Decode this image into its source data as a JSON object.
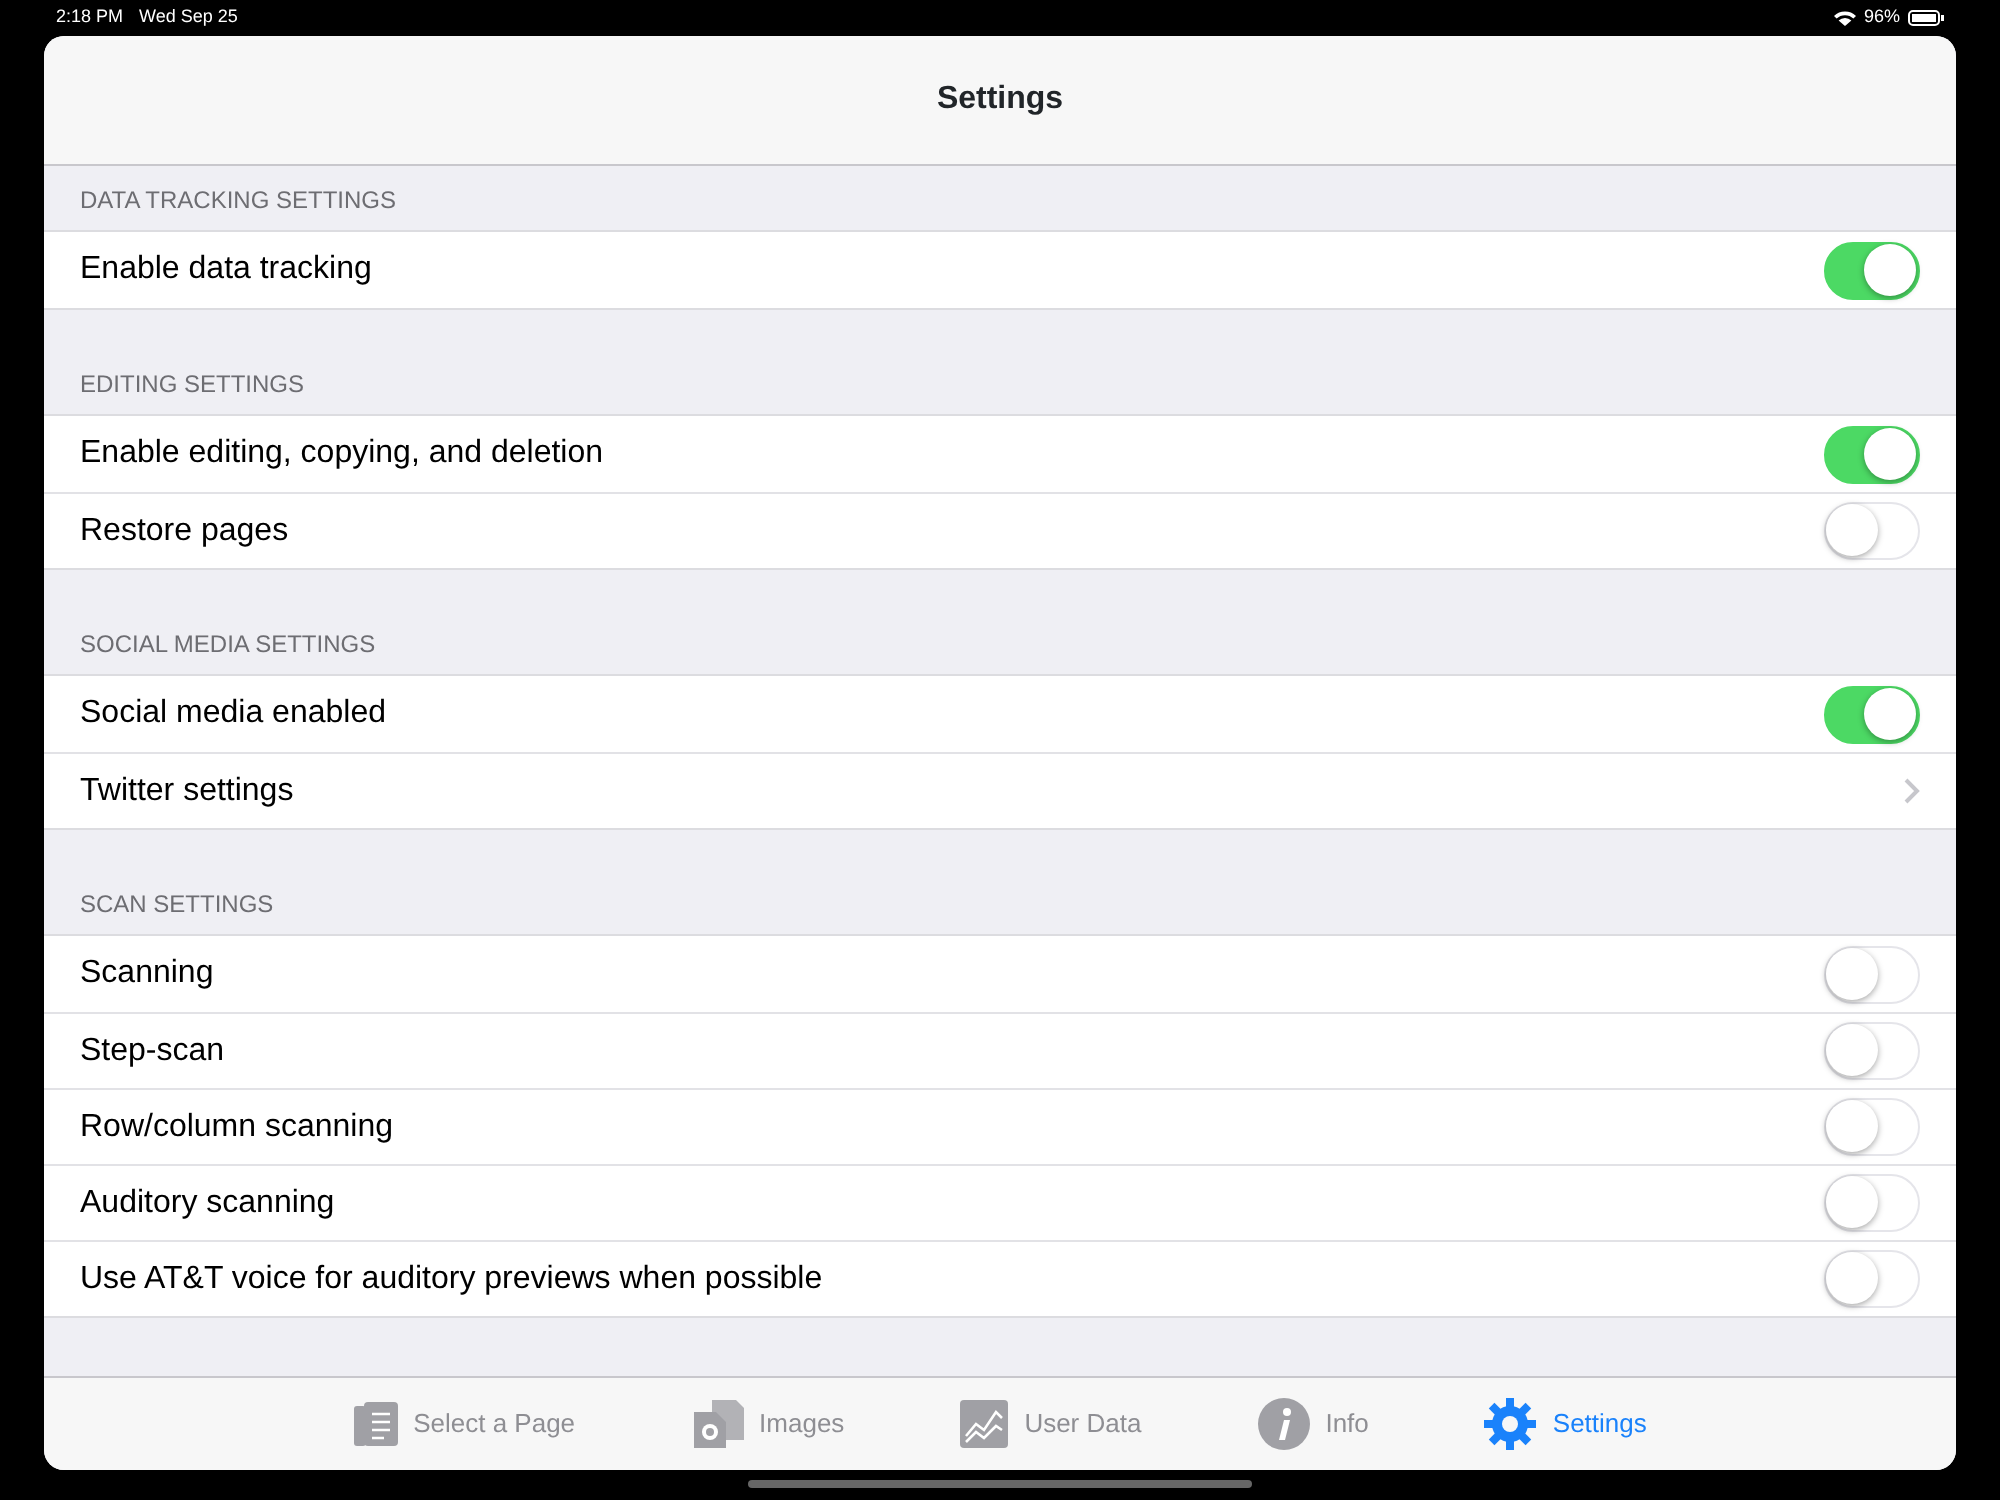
{
  "status_bar": {
    "time": "2:18 PM",
    "date": "Wed Sep 25",
    "battery": "96%"
  },
  "navigation_bar": {
    "title": "Settings"
  },
  "sections": [
    {
      "header": "DATA TRACKING SETTINGS",
      "rows": [
        {
          "kind": "toggle",
          "label": "Enable data tracking",
          "on": true
        }
      ]
    },
    {
      "header": "EDITING SETTINGS",
      "rows": [
        {
          "kind": "toggle",
          "label": "Enable editing, copying, and deletion",
          "on": true
        },
        {
          "kind": "toggle",
          "label": "Restore pages",
          "on": false
        }
      ]
    },
    {
      "header": "SOCIAL MEDIA SETTINGS",
      "rows": [
        {
          "kind": "toggle",
          "label": "Social media enabled",
          "on": true
        },
        {
          "kind": "link",
          "label": "Twitter settings"
        }
      ]
    },
    {
      "header": "SCAN SETTINGS",
      "rows": [
        {
          "kind": "toggle",
          "label": "Scanning",
          "on": false
        },
        {
          "kind": "toggle",
          "label": "Step-scan",
          "on": false
        },
        {
          "kind": "toggle",
          "label": "Row/column scanning",
          "on": false
        },
        {
          "kind": "toggle",
          "label": "Auditory scanning",
          "on": false
        },
        {
          "kind": "toggle",
          "label": "Use AT&T voice for auditory previews when possible",
          "on": false
        }
      ]
    }
  ],
  "tab_bar": [
    {
      "kind": "page",
      "label": "Select a Page",
      "selected": false
    },
    {
      "kind": "images",
      "label": "Images",
      "selected": false
    },
    {
      "kind": "chart",
      "label": "User Data",
      "selected": false
    },
    {
      "kind": "info",
      "label": "Info",
      "selected": false
    },
    {
      "kind": "gear",
      "label": "Settings",
      "selected": true
    }
  ]
}
